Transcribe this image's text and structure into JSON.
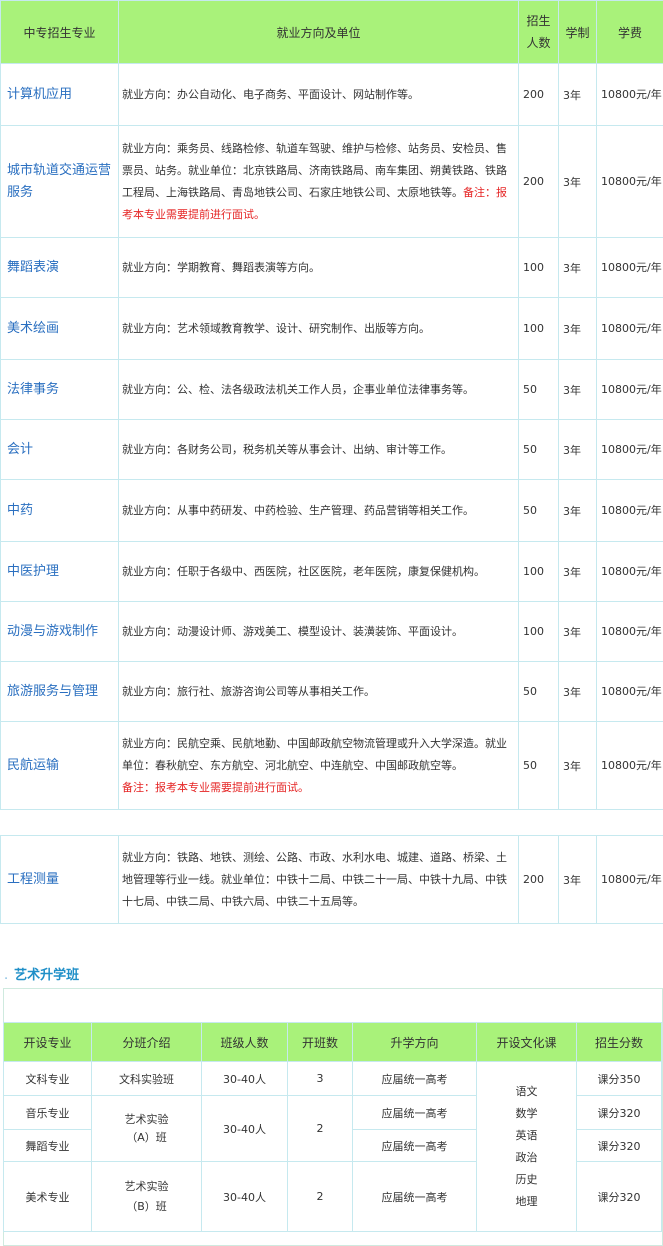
{
  "majors": {
    "headers": {
      "major": "中专招生专业",
      "direction": "就业方向及单位",
      "count_l1": "招生",
      "count_l2": "人数",
      "years": "学制",
      "fee": "学费"
    },
    "rows": [
      {
        "name": "计算机应用",
        "dir": "就业方向：办公自动化、电子商务、平面设计、网站制作等。",
        "note": "",
        "count": "200",
        "years": "3年",
        "fee": "10800元/年"
      },
      {
        "name": "城市轨道交通运营服务",
        "dir": "就业方向：乘务员、线路检修、轨道车驾驶、维护与检修、站务员、安检员、售票员、站务。就业单位：北京铁路局、济南铁路局、南车集团、朔黄铁路、铁路工程局、上海铁路局、青岛地铁公司、石家庄地铁公司、太原地铁等。",
        "note": "备注：报考本专业需要提前进行面试。",
        "count": "200",
        "years": "3年",
        "fee": "10800元/年"
      },
      {
        "name": "舞蹈表演",
        "dir": "就业方向：学期教育、舞蹈表演等方向。",
        "note": "",
        "count": "100",
        "years": "3年",
        "fee": "10800元/年"
      },
      {
        "name": "美术绘画",
        "dir": "就业方向：艺术领域教育教学、设计、研究制作、出版等方向。",
        "note": "",
        "count": "100",
        "years": "3年",
        "fee": "10800元/年"
      },
      {
        "name": "法律事务",
        "dir": "就业方向：公、检、法各级政法机关工作人员，企事业单位法律事务等。",
        "note": "",
        "count": "50",
        "years": "3年",
        "fee": "10800元/年"
      },
      {
        "name": "会计",
        "dir": "就业方向：各财务公司，税务机关等从事会计、出纳、审计等工作。",
        "note": "",
        "count": "50",
        "years": "3年",
        "fee": "10800元/年"
      },
      {
        "name": "中药",
        "dir": "就业方向：从事中药研发、中药检验、生产管理、药品营销等相关工作。",
        "note": "",
        "count": "50",
        "years": "3年",
        "fee": "10800元/年"
      },
      {
        "name": "中医护理",
        "dir": "就业方向：任职于各级中、西医院，社区医院，老年医院，康复保健机构。",
        "note": "",
        "count": "100",
        "years": "3年",
        "fee": "10800元/年"
      },
      {
        "name": "动漫与游戏制作",
        "dir": "就业方向：动漫设计师、游戏美工、模型设计、装潢装饰、平面设计。",
        "note": "",
        "count": "100",
        "years": "3年",
        "fee": "10800元/年"
      },
      {
        "name": "旅游服务与管理",
        "dir": "就业方向：旅行社、旅游咨询公司等从事相关工作。",
        "note": "",
        "count": "50",
        "years": "3年",
        "fee": "10800元/年"
      },
      {
        "name": "民航运输",
        "dir": "就业方向：民航空乘、民航地勤、中国邮政航空物流管理或升入大学深造。就业单位：春秋航空、东方航空、河北航空、中连航空、中国邮政航空等。",
        "note": "备注：报考本专业需要提前进行面试。",
        "count": "50",
        "years": "3年",
        "fee": "10800元/年"
      },
      {
        "name": "工程测量",
        "dir": "就业方向：铁路、地铁、测绘、公路、市政、水利水电、城建、道路、桥梁、土地管理等行业一线。就业单位：中铁十二局、中铁二十一局、中铁十九局、中铁十七局、中铁二局、中铁六局、中铁二十五局等。",
        "note": "",
        "count": "200",
        "years": "3年",
        "fee": "10800元/年"
      }
    ]
  },
  "art": {
    "title": "艺术升学班",
    "headers": [
      "开设专业",
      "分班介绍",
      "班级人数",
      "开班数",
      "升学方向",
      "开设文化课",
      "招生分数"
    ],
    "rows": [
      {
        "major": "文科专业",
        "intro": "文科实验班",
        "size": "30-40人",
        "classes": "3",
        "dir": "应届统一高考",
        "score": "课分350"
      },
      {
        "major": "音乐专业",
        "intro": "艺术实验（A）班",
        "size": "30-40人",
        "classes": "2",
        "dir": "应届统一高考",
        "score": "课分320"
      },
      {
        "major": "舞蹈专业",
        "dir": "应届统一高考",
        "score": "课分320"
      },
      {
        "major": "美术专业",
        "intro": "艺术实验（B）班",
        "size": "30-40人",
        "classes": "2",
        "dir": "应届统一高考",
        "score": "课分320"
      }
    ],
    "intro_a_l1": "艺术实验",
    "intro_a_l2": "（A）班",
    "intro_b_l1": "艺术实验",
    "intro_b_l2": "（B）班",
    "culture": [
      "语文",
      "数学",
      "英语",
      "政治",
      "历史",
      "地理"
    ]
  }
}
